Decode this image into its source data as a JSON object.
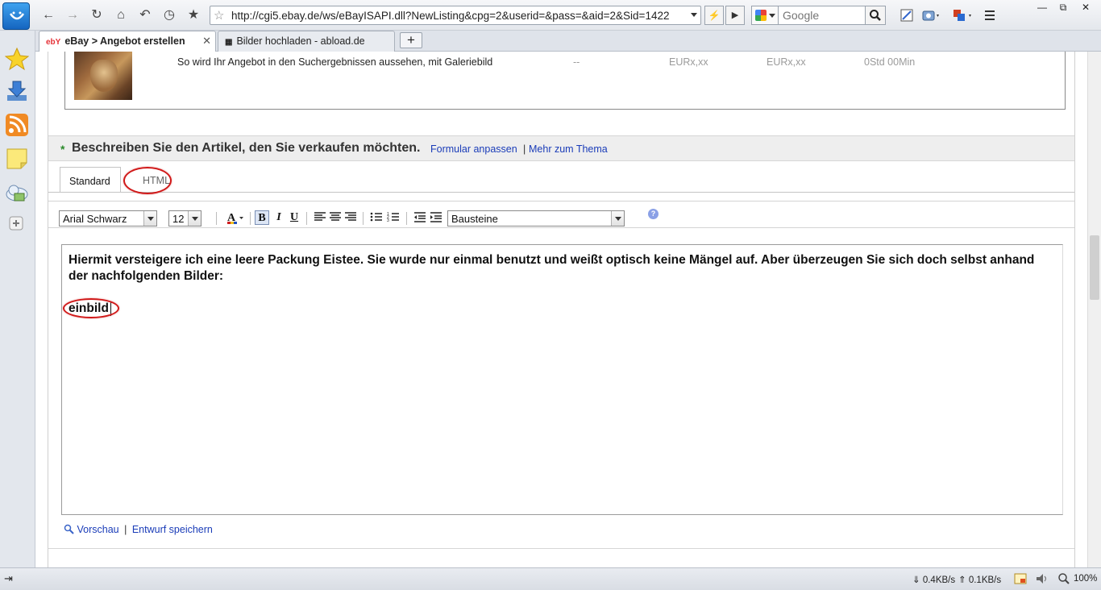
{
  "browser": {
    "url": "http://cgi5.ebay.de/ws/eBayISAPI.dll?NewListing&cpg=2&userid=&pass=&aid=2&Sid=1422",
    "search_placeholder": "Google",
    "tabs": [
      {
        "label": "eBay > Angebot erstellen",
        "favicon": "ebY"
      },
      {
        "label": "Bilder hochladen - abload.de"
      }
    ],
    "new_tab_label": "+",
    "status": {
      "down": "0.4KB/s",
      "up": "0.1KB/s",
      "zoom": "100%"
    }
  },
  "preview_row": {
    "text": "So wird Ihr Angebot in den Suchergebnissen aussehen, mit Galeriebild",
    "col1": "--",
    "col2": "EURx,xx",
    "col3": "EURx,xx",
    "col4": "0Std 00Min"
  },
  "section": {
    "required_mark": "*",
    "title": "Beschreiben Sie den Artikel, den Sie verkaufen möchten.",
    "link1": "Formular anpassen",
    "sep": "|",
    "link2": "Mehr zum Thema"
  },
  "editor": {
    "tab_standard": "Standard",
    "tab_html": "HTML",
    "font_family": "Arial Schwarz",
    "font_size": "12",
    "blocks_select": "Bausteine",
    "help": "?",
    "body_text": "Hiermit versteigere ich eine leere Packung Eistee. Sie wurde nur einmal benutzt und weißt optisch keine Mängel auf. Aber überzeugen Sie sich doch selbst anhand der nachfolgenden Bilder:",
    "typed_text": "einbild",
    "link_preview": "Vorschau",
    "link_sep": "|",
    "link_draft": "Entwurf speichern"
  },
  "colors": {
    "link": "#1a3cb8",
    "required": "#2a8a2a",
    "annotation": "#d01818"
  }
}
